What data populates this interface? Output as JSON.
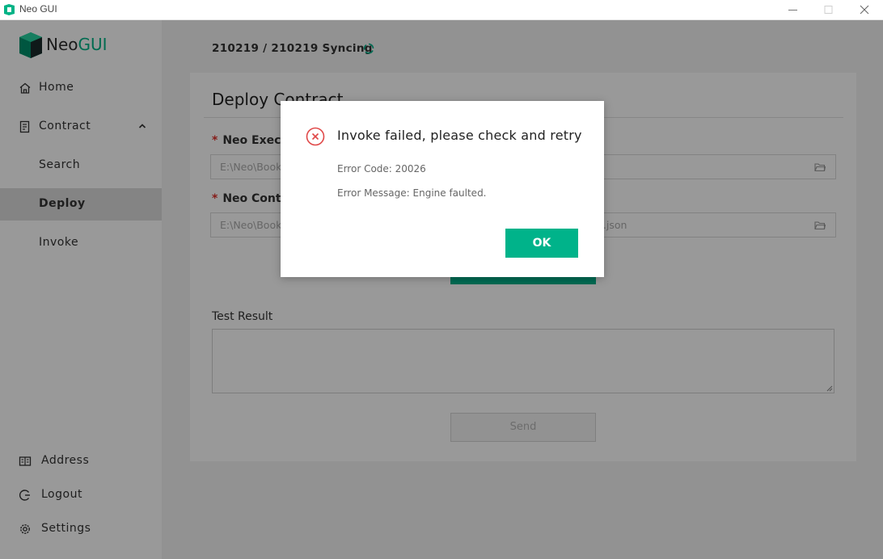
{
  "window": {
    "title": "Neo GUI"
  },
  "logo": {
    "neo": "Neo",
    "gui": "GUI"
  },
  "sidebar": {
    "items": [
      {
        "label": "Home",
        "icon": "home-icon"
      },
      {
        "label": "Contract",
        "icon": "contract-icon"
      },
      {
        "label": "Search",
        "icon": ""
      },
      {
        "label": "Deploy",
        "icon": ""
      },
      {
        "label": "Invoke",
        "icon": ""
      }
    ],
    "bottom": [
      {
        "label": "Address",
        "icon": "address-book-icon"
      },
      {
        "label": "Logout",
        "icon": "logout-icon"
      },
      {
        "label": "Settings",
        "icon": "gear-icon"
      }
    ],
    "active": "Deploy"
  },
  "header": {
    "sync_text": "210219 / 210219 Syncing"
  },
  "deploy": {
    "title": "Deploy Contract",
    "executable_label": "Neo Execu",
    "executable_value": "E:\\Neo\\Book",
    "manifest_label": "Neo Contra",
    "manifest_value": "E:\\Neo\\Book",
    "manifest_value_tail": "t.json",
    "result_label": "Test Result",
    "send_label": "Send"
  },
  "modal": {
    "title": "Invoke failed, please check and retry",
    "error_code": "Error Code: 20026",
    "error_message": "Error Message: Engine faulted.",
    "ok_label": "OK"
  },
  "colors": {
    "accent": "#00b38a",
    "error": "#e04848",
    "active_nav_bg": "#dcdcdc"
  }
}
